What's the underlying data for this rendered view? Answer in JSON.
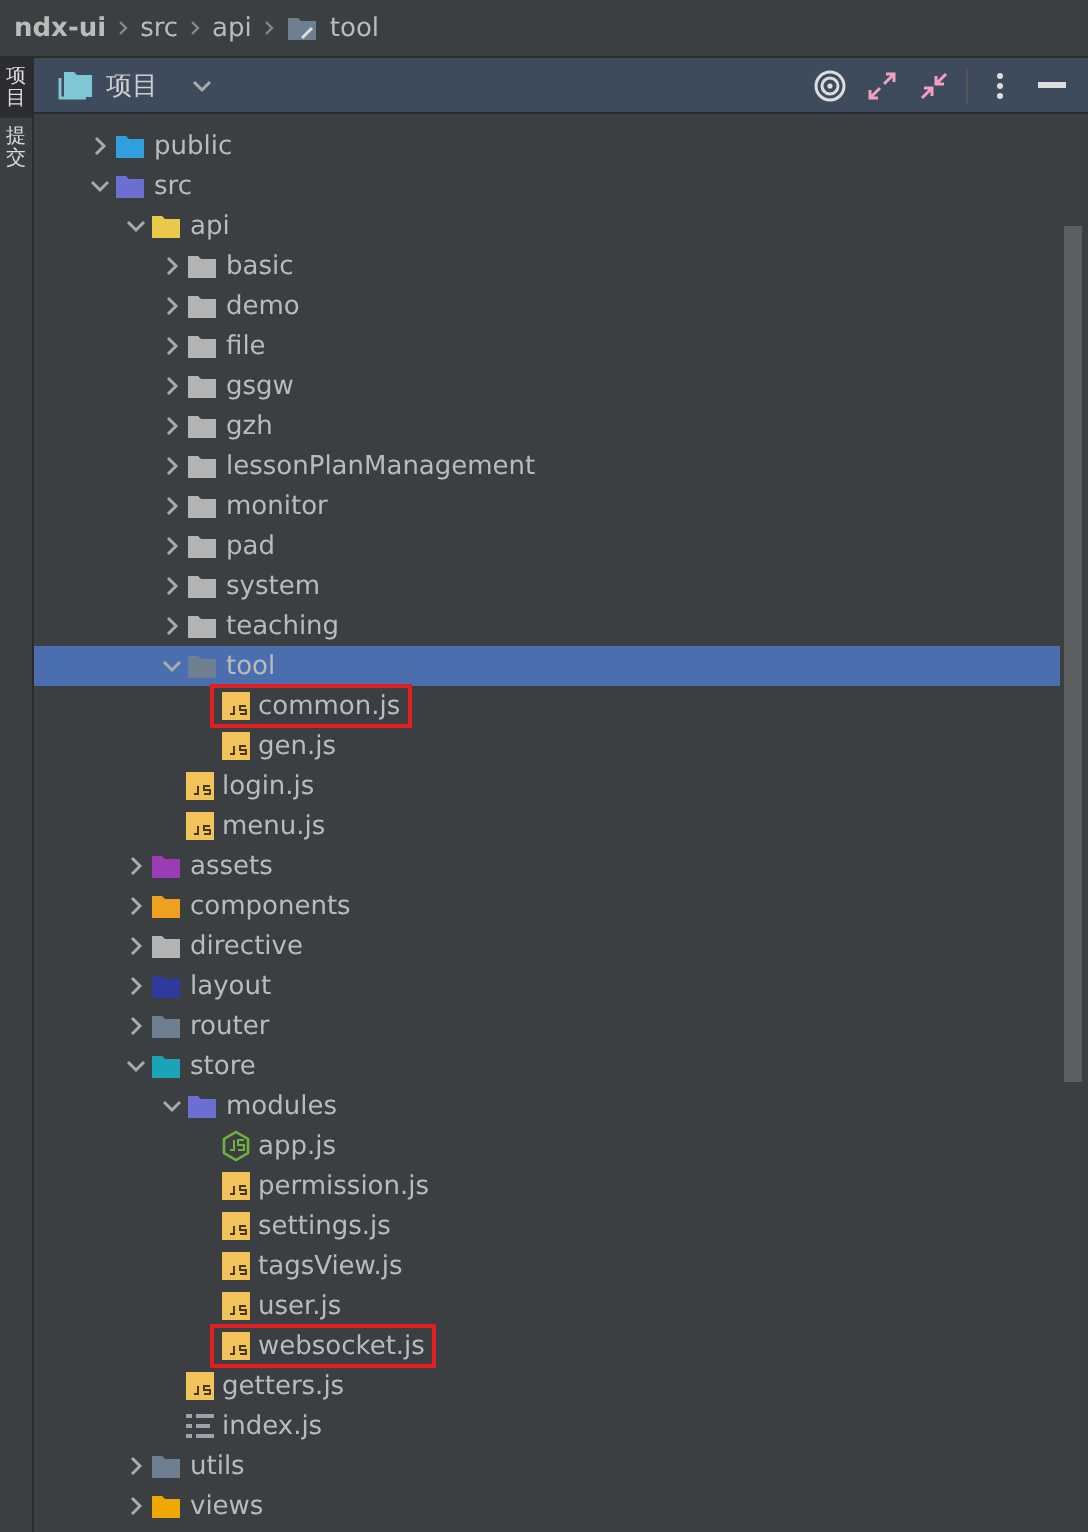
{
  "breadcrumb": [
    {
      "label": "ndx-ui",
      "kind": "root"
    },
    {
      "label": "src",
      "kind": "plain"
    },
    {
      "label": "api",
      "kind": "plain"
    },
    {
      "label": "tool",
      "kind": "tool"
    }
  ],
  "side_tabs": [
    {
      "label": "项目",
      "selected": true
    },
    {
      "label": "提交",
      "selected": false
    }
  ],
  "panel": {
    "title": "项目"
  },
  "tree": [
    {
      "name": "public",
      "kind": "folder",
      "color": "#2f9fe0",
      "expanded": false,
      "selected": false,
      "marked": false
    },
    {
      "name": "src",
      "kind": "folder",
      "color": "#6b6fd1",
      "expanded": true,
      "selected": false,
      "marked": false,
      "children": [
        {
          "name": "api",
          "kind": "folder",
          "color": "#e8c94a",
          "expanded": true,
          "selected": false,
          "marked": false,
          "children": [
            {
              "name": "basic",
              "kind": "folder",
              "color": "#b4b4b4",
              "expanded": false,
              "selected": false,
              "marked": false
            },
            {
              "name": "demo",
              "kind": "folder",
              "color": "#b4b4b4",
              "expanded": false,
              "selected": false,
              "marked": false
            },
            {
              "name": "file",
              "kind": "folder",
              "color": "#b4b4b4",
              "expanded": false,
              "selected": false,
              "marked": false
            },
            {
              "name": "gsgw",
              "kind": "folder",
              "color": "#b4b4b4",
              "expanded": false,
              "selected": false,
              "marked": false
            },
            {
              "name": "gzh",
              "kind": "folder",
              "color": "#b4b4b4",
              "expanded": false,
              "selected": false,
              "marked": false
            },
            {
              "name": "lessonPlanManagement",
              "kind": "folder",
              "color": "#b4b4b4",
              "expanded": false,
              "selected": false,
              "marked": false
            },
            {
              "name": "monitor",
              "kind": "folder",
              "color": "#b4b4b4",
              "expanded": false,
              "selected": false,
              "marked": false
            },
            {
              "name": "pad",
              "kind": "folder",
              "color": "#b4b4b4",
              "expanded": false,
              "selected": false,
              "marked": false
            },
            {
              "name": "system",
              "kind": "folder",
              "color": "#b4b4b4",
              "expanded": false,
              "selected": false,
              "marked": false
            },
            {
              "name": "teaching",
              "kind": "folder",
              "color": "#b4b4b4",
              "expanded": false,
              "selected": false,
              "marked": false
            },
            {
              "name": "tool",
              "kind": "folder",
              "color": "#6e7f8f",
              "expanded": true,
              "selected": true,
              "marked": false,
              "children": [
                {
                  "name": "common.js",
                  "kind": "js",
                  "selected": false,
                  "marked": true
                },
                {
                  "name": "gen.js",
                  "kind": "js",
                  "selected": false,
                  "marked": false
                }
              ]
            },
            {
              "name": "login.js",
              "kind": "js",
              "selected": false,
              "marked": false
            },
            {
              "name": "menu.js",
              "kind": "js",
              "selected": false,
              "marked": false
            }
          ]
        },
        {
          "name": "assets",
          "kind": "folder",
          "color": "#9b3cb7",
          "expanded": false,
          "selected": false,
          "marked": false
        },
        {
          "name": "components",
          "kind": "folder",
          "color": "#f0a020",
          "expanded": false,
          "selected": false,
          "marked": false
        },
        {
          "name": "directive",
          "kind": "folder",
          "color": "#b4b4b4",
          "expanded": false,
          "selected": false,
          "marked": false
        },
        {
          "name": "layout",
          "kind": "folder",
          "color": "#2e3a9c",
          "expanded": false,
          "selected": false,
          "marked": false
        },
        {
          "name": "router",
          "kind": "folder",
          "color": "#6e7f8f",
          "expanded": false,
          "selected": false,
          "marked": false
        },
        {
          "name": "store",
          "kind": "folder",
          "color": "#1ba3b8",
          "expanded": true,
          "selected": false,
          "marked": false,
          "children": [
            {
              "name": "modules",
              "kind": "folder",
              "color": "#6b6fd1",
              "expanded": true,
              "selected": false,
              "marked": false,
              "children": [
                {
                  "name": "app.js",
                  "kind": "nodejs",
                  "selected": false,
                  "marked": false
                },
                {
                  "name": "permission.js",
                  "kind": "js",
                  "selected": false,
                  "marked": false
                },
                {
                  "name": "settings.js",
                  "kind": "js",
                  "selected": false,
                  "marked": false
                },
                {
                  "name": "tagsView.js",
                  "kind": "js",
                  "selected": false,
                  "marked": false
                },
                {
                  "name": "user.js",
                  "kind": "js",
                  "selected": false,
                  "marked": false
                },
                {
                  "name": "websocket.js",
                  "kind": "js",
                  "selected": false,
                  "marked": true
                }
              ]
            },
            {
              "name": "getters.js",
              "kind": "js",
              "selected": false,
              "marked": false
            },
            {
              "name": "index.js",
              "kind": "list",
              "selected": false,
              "marked": false
            }
          ]
        },
        {
          "name": "utils",
          "kind": "folder",
          "color": "#6e7f8f",
          "expanded": false,
          "selected": false,
          "marked": false
        },
        {
          "name": "views",
          "kind": "folder",
          "color": "#f0a800",
          "expanded": false,
          "selected": false,
          "marked": false
        }
      ]
    }
  ]
}
